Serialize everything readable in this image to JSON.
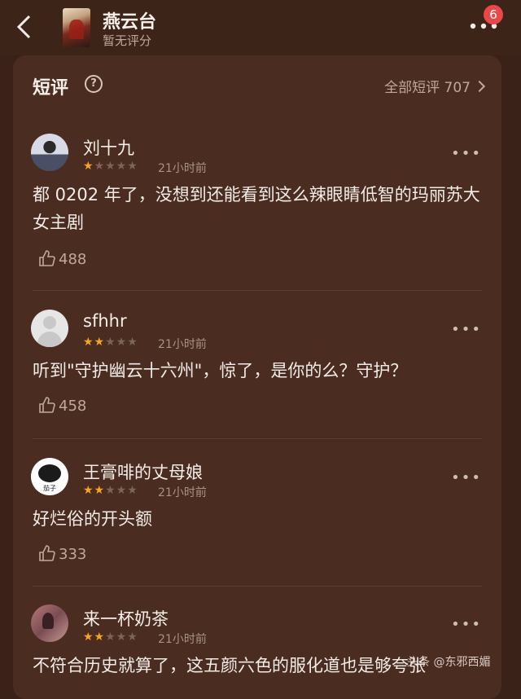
{
  "header": {
    "title": "燕云台",
    "subtitle": "暂无评分",
    "notification_count": "6"
  },
  "section": {
    "title": "短评",
    "help_glyph": "?",
    "all_link": "全部短评 707"
  },
  "reviews": [
    {
      "name": "刘十九",
      "rating": 1,
      "time": "21小时前",
      "text": "都 0202 年了，没想到还能看到这么辣眼睛低智的玛丽苏大女主剧",
      "likes": "488",
      "stars_on": "★",
      "stars_off": "★★★★"
    },
    {
      "name": "sfhhr",
      "rating": 2,
      "time": "21小时前",
      "text": "听到\"守护幽云十六州\"，惊了，是你的么？守护？",
      "likes": "458",
      "stars_on": "★★",
      "stars_off": "★★★"
    },
    {
      "name": "王膏啡的丈母娘",
      "rating": 2,
      "time": "21小时前",
      "text": "好烂俗的开头额",
      "likes": "333",
      "stars_on": "★★",
      "stars_off": "★★★",
      "avatar_tag": "茄子"
    },
    {
      "name": "来一杯奶茶",
      "rating": 2,
      "time": "21小时前",
      "text": "不符合历史就算了，这五颜六色的服化道也是够夸张",
      "likes": "",
      "stars_on": "★★",
      "stars_off": "★★★"
    }
  ],
  "watermark": "头条 @东邪西媚",
  "colors": {
    "background": "#3a2218",
    "card": "#4a2c21",
    "star": "#f5a623",
    "badge": "#e8484a"
  }
}
